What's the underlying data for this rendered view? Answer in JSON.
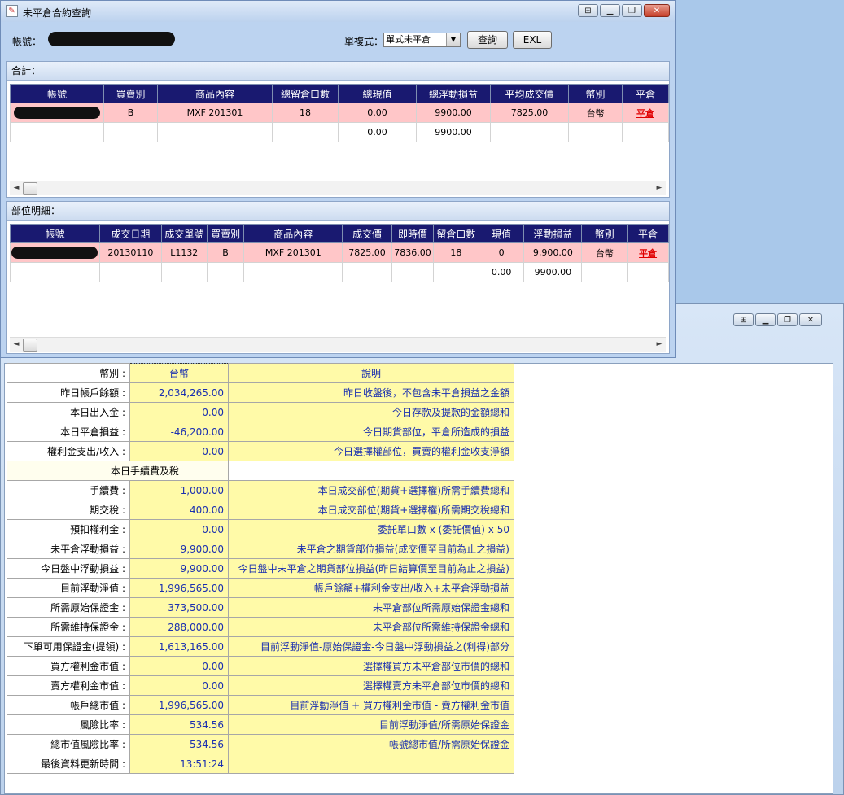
{
  "main_window": {
    "title": "未平倉合約查詢",
    "controls": {
      "minimize": "▁",
      "restore": "❐",
      "close": "✕",
      "pin": "⊞"
    }
  },
  "back_window": {
    "controls": {
      "minimize": "▁",
      "restore": "❐",
      "close": "✕",
      "pin": "⊞"
    }
  },
  "toolbar": {
    "account_label": "帳號：",
    "mode_label": "單複式：",
    "mode_value": "單式未平倉",
    "query_label": "查詢",
    "export_label": "EXL"
  },
  "summary": {
    "section_title": "合計：",
    "columns": [
      "帳號",
      "買賣別",
      "商品內容",
      "總留倉口數",
      "總現值",
      "總浮動損益",
      "平均成交價",
      "幣別",
      "平倉"
    ],
    "row": {
      "side": "B",
      "product": "MXF 201301",
      "open_qty": "18",
      "market_value": "0.00",
      "float_pl": "9900.00",
      "avg_price": "7825.00",
      "currency": "台幣",
      "action": "平倉"
    },
    "total": {
      "market_value": "0.00",
      "float_pl": "9900.00"
    }
  },
  "detail": {
    "section_title": "部位明細：",
    "columns": [
      "帳號",
      "成交日期",
      "成交單號",
      "買賣別",
      "商品內容",
      "成交價",
      "即時價",
      "留倉口數",
      "現值",
      "浮動損益",
      "幣別",
      "平倉"
    ],
    "row": {
      "trade_date": "20130110",
      "order_no": "L1132",
      "side": "B",
      "product": "MXF 201301",
      "trade_price": "7825.00",
      "last_price": "7836.00",
      "open_qty": "18",
      "market_value": "0",
      "float_pl": "9,900.00",
      "currency": "台幣",
      "action": "平倉"
    },
    "total": {
      "market_value": "0.00",
      "float_pl": "9900.00"
    }
  },
  "account": {
    "header": {
      "label": "幣別 :",
      "value": "台幣",
      "desc": "說明"
    },
    "fee_section": "本日手續費及稅",
    "rows": [
      {
        "label": "昨日帳戶餘額 :",
        "value": "2,034,265.00",
        "desc": "昨日收盤後，不包含未平倉損益之金額"
      },
      {
        "label": "本日出入金 :",
        "value": "0.00",
        "desc": "今日存款及提款的金額總和"
      },
      {
        "label": "本日平倉損益 :",
        "value": "-46,200.00",
        "desc": "今日期貨部位，平倉所造成的損益"
      },
      {
        "label": "權利金支出/收入 :",
        "value": "0.00",
        "desc": "今日選擇權部位，買賣的權利金收支淨額"
      },
      {
        "label": "手續費 :",
        "value": "1,000.00",
        "desc": "本日成交部位(期貨+選擇權)所需手續費總和"
      },
      {
        "label": "期交稅 :",
        "value": "400.00",
        "desc": "本日成交部位(期貨+選擇權)所需期交稅總和"
      },
      {
        "label": "預扣權利金 :",
        "value": "0.00",
        "desc": "委託單口數 x (委託價值) x 50"
      },
      {
        "label": "未平倉浮動損益 :",
        "value": "9,900.00",
        "desc": "未平倉之期貨部位損益(成交價至目前為止之損益)"
      },
      {
        "label": "今日盤中浮動損益 :",
        "value": "9,900.00",
        "desc": "今日盤中未平倉之期貨部位損益(昨日結算價至目前為止之損益)"
      },
      {
        "label": "目前浮動淨值 :",
        "value": "1,996,565.00",
        "desc": "帳戶餘額+權利金支出/收入+未平倉浮動損益"
      },
      {
        "label": "所需原始保證金 :",
        "value": "373,500.00",
        "desc": "未平倉部位所需原始保證金總和"
      },
      {
        "label": "所需維持保證金 :",
        "value": "288,000.00",
        "desc": "未平倉部位所需維持保證金總和"
      },
      {
        "label": "下單可用保證金(提領) :",
        "value": "1,613,165.00",
        "desc": "目前浮動淨值-原始保證金-今日盤中浮動損益之(利得)部分"
      },
      {
        "label": "買方權利金市值 :",
        "value": "0.00",
        "desc": "選擇權買方未平倉部位市價的總和"
      },
      {
        "label": "賣方權利金市值 :",
        "value": "0.00",
        "desc": "選擇權賣方未平倉部位市價的總和"
      },
      {
        "label": "帳戶總市值 :",
        "value": "1,996,565.00",
        "desc": "目前浮動淨值 + 買方權利金市值 - 賣方權利金市值"
      },
      {
        "label": "風險比率 :",
        "value": "534.56",
        "desc": "目前浮動淨值/所需原始保證金"
      },
      {
        "label": "總市值風險比率 :",
        "value": "534.56",
        "desc": "帳號總市值/所需原始保證金"
      },
      {
        "label": "最後資料更新時間 :",
        "value": "13:51:24",
        "desc": ""
      }
    ]
  }
}
